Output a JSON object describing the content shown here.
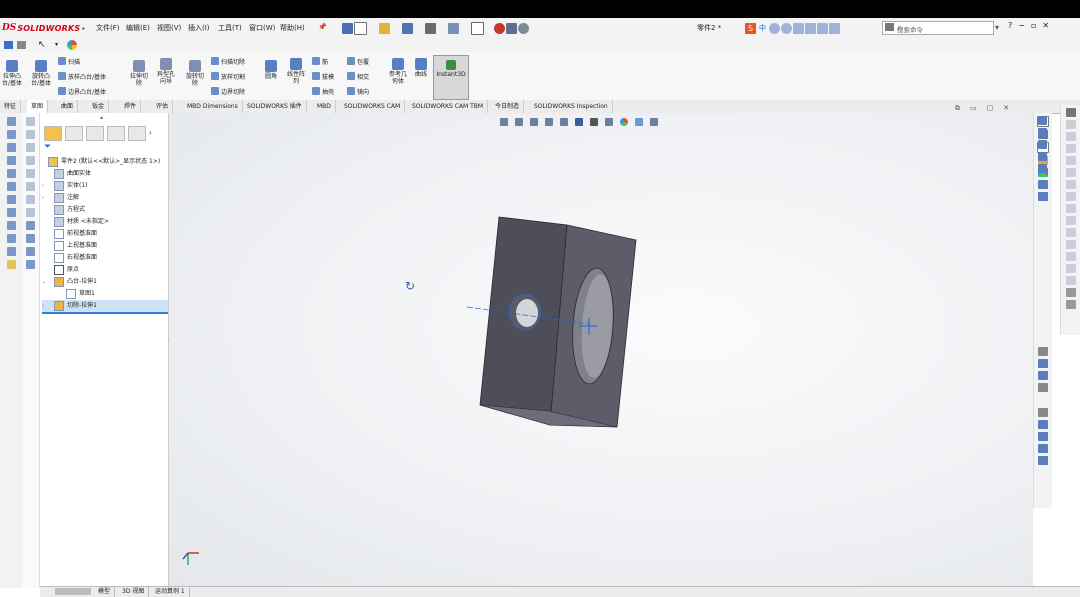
{
  "app": {
    "logo_ds": "DS",
    "logo_text": "SOLIDWORKS",
    "doc_title": "零件2 *",
    "search_placeholder": "搜索命令"
  },
  "menu": [
    "文件(F)",
    "编辑(E)",
    "视图(V)",
    "插入(I)",
    "工具(T)",
    "窗口(W)",
    "帮助(H)"
  ],
  "window_controls": [
    "?",
    "−",
    "▫",
    "✕"
  ],
  "command_manager": {
    "extrude_boss": "拉伸凸\n台/基体",
    "revolve_boss": "旋转凸\n台/基体",
    "sweep": "扫描",
    "loft": "放样凸台/基体",
    "boundary_boss": "边界凸台/基体",
    "extrude_cut": "拉伸切\n除",
    "hole_wizard": "异型孔\n向导",
    "revolve_cut": "旋转切\n除",
    "sweep_cut": "扫描切除",
    "loft_cut": "放样切割",
    "boundary_cut": "边界切除",
    "fillet": "圆角",
    "linear_pattern": "线性阵\n列",
    "rib": "筋",
    "draft": "拔模",
    "shell": "抽壳",
    "wrap": "包覆",
    "intersect": "相交",
    "mirror": "镜向",
    "ref_geometry": "参考几\n何体",
    "curves": "曲线",
    "instant3d": "Instant3D"
  },
  "tabs": [
    "特征",
    "草图",
    "曲面",
    "钣金",
    "焊件",
    "评估",
    "MBD Dimensions",
    "SOLIDWORKS 插件",
    "MBD",
    "SOLIDWORKS CAM",
    "SOLIDWORKS CAM TBM",
    "今日制造",
    "SOLIDWORKS Inspection"
  ],
  "tree": [
    {
      "label": "零件2 (默认<<默认>_显示状态 1>)",
      "expand": ""
    },
    {
      "label": "曲面实体",
      "expand": ""
    },
    {
      "label": "实体(1)",
      "expand": "›"
    },
    {
      "label": "注解",
      "expand": "›"
    },
    {
      "label": "方程式",
      "expand": ""
    },
    {
      "label": "材质 <未指定>",
      "expand": ""
    },
    {
      "label": "前视基准面",
      "expand": ""
    },
    {
      "label": "上视基准面",
      "expand": ""
    },
    {
      "label": "右视基准面",
      "expand": ""
    },
    {
      "label": "原点",
      "expand": ""
    },
    {
      "label": "凸台-拉伸1",
      "expand": "⌄"
    },
    {
      "label": "草图1",
      "expand": ""
    },
    {
      "label": "切除-拉伸1",
      "expand": "›"
    }
  ],
  "bottom_tabs": [
    "模型",
    "3D 视图",
    "运动算例 1"
  ],
  "colors": {
    "accent_red": "#d0021b",
    "part_face_dark": "#4d4e58",
    "part_face_mid": "#5c5d68",
    "part_face_light": "#6c6d78",
    "selection_blue": "#1e63d8"
  }
}
